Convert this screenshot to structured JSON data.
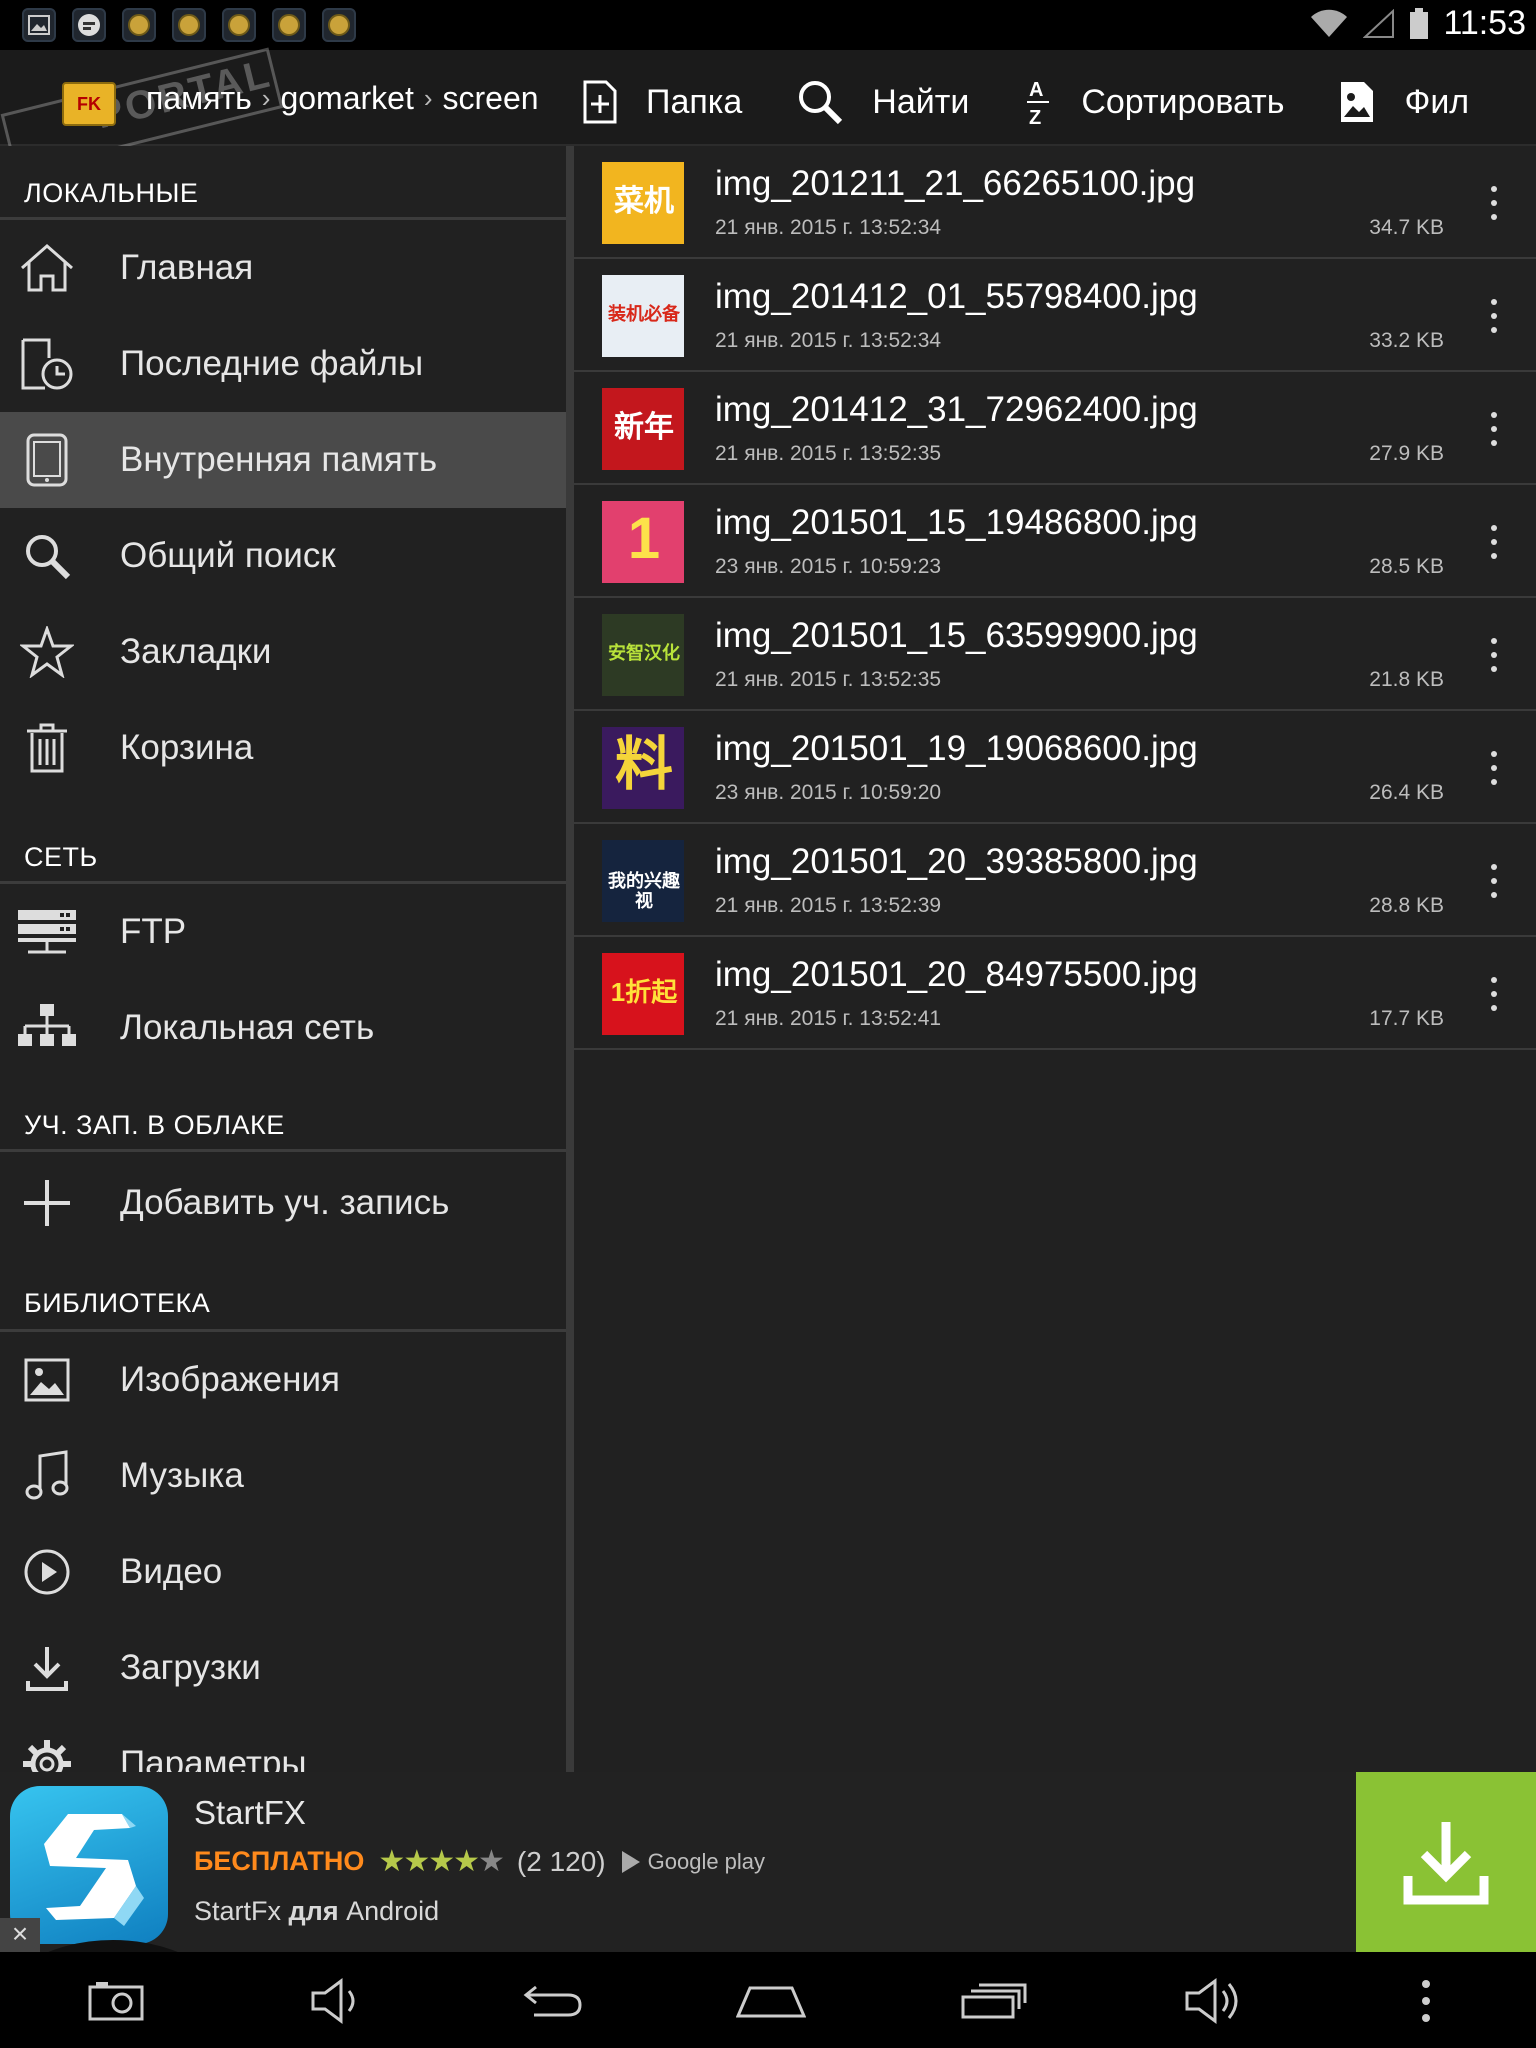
{
  "status_bar": {
    "time": "11:53"
  },
  "action_bar": {
    "watermark": "PORTAL",
    "app_logo": "FK",
    "breadcrumb": [
      "память",
      "gomarket",
      "screen"
    ],
    "toolbar": [
      {
        "label": "Папка",
        "icon": "new-folder-icon"
      },
      {
        "label": "Найти",
        "icon": "search-icon"
      },
      {
        "label": "Сортировать",
        "icon": "sort-az-icon"
      },
      {
        "label": "Фил",
        "icon": "image-filter-icon"
      }
    ]
  },
  "sidebar": {
    "sections": [
      {
        "header": "ЛОКАЛЬНЫЕ",
        "items": [
          {
            "label": "Главная",
            "icon": "home-icon"
          },
          {
            "label": "Последние файлы",
            "icon": "recent-files-icon"
          },
          {
            "label": "Внутренняя память",
            "icon": "tablet-icon",
            "active": true
          },
          {
            "label": "Общий поиск",
            "icon": "search-icon"
          },
          {
            "label": "Закладки",
            "icon": "star-icon"
          },
          {
            "label": "Корзина",
            "icon": "trash-icon"
          }
        ]
      },
      {
        "header": "СЕТЬ",
        "items": [
          {
            "label": "FTP",
            "icon": "ftp-server-icon"
          },
          {
            "label": "Локальная сеть",
            "icon": "network-icon"
          }
        ]
      },
      {
        "header": "УЧ. ЗАП. В ОБЛАКЕ",
        "items": [
          {
            "label": "Добавить уч. запись",
            "icon": "plus-icon"
          }
        ]
      },
      {
        "header": "БИБЛИОТЕКА",
        "items": [
          {
            "label": "Изображения",
            "icon": "image-icon"
          },
          {
            "label": "Музыка",
            "icon": "music-note-icon"
          },
          {
            "label": "Видео",
            "icon": "play-circle-icon"
          },
          {
            "label": "Загрузки",
            "icon": "download-icon"
          },
          {
            "label": "Параметры",
            "icon": "gear-icon"
          }
        ]
      }
    ]
  },
  "files": [
    {
      "name": "img_201211_21_66265100.jpg",
      "date": "21 янв. 2015 г. 13:52:34",
      "size": "34.7 KB",
      "thumb_bg": "#f2b51f",
      "thumb_text": "菜机",
      "thumb_color": "#ffffff"
    },
    {
      "name": "img_201412_01_55798400.jpg",
      "date": "21 янв. 2015 г. 13:52:34",
      "size": "33.2 KB",
      "thumb_bg": "#e8eef4",
      "thumb_text": "装机必备",
      "thumb_color": "#d8281a"
    },
    {
      "name": "img_201412_31_72962400.jpg",
      "date": "21 янв. 2015 г. 13:52:35",
      "size": "27.9 KB",
      "thumb_bg": "#c3171d",
      "thumb_text": "新年",
      "thumb_color": "#ffffff"
    },
    {
      "name": "img_201501_15_19486800.jpg",
      "date": "23 янв. 2015 г. 10:59:23",
      "size": "28.5 KB",
      "thumb_bg": "#e2406e",
      "thumb_text": "1",
      "thumb_color": "#fde24a"
    },
    {
      "name": "img_201501_15_63599900.jpg",
      "date": "21 янв. 2015 г. 13:52:35",
      "size": "21.8 KB",
      "thumb_bg": "#2d3a24",
      "thumb_text": "安智汉化",
      "thumb_color": "#b8e23a"
    },
    {
      "name": "img_201501_19_19068600.jpg",
      "date": "23 янв. 2015 г. 10:59:20",
      "size": "26.4 KB",
      "thumb_bg": "#3a1a5e",
      "thumb_text": "料",
      "thumb_color": "#f5d53a"
    },
    {
      "name": "img_201501_20_39385800.jpg",
      "date": "21 янв. 2015 г. 13:52:39",
      "size": "28.8 KB",
      "thumb_bg": "#15243e",
      "thumb_text": "我的兴趣视",
      "thumb_color": "#ffffff"
    },
    {
      "name": "img_201501_20_84975500.jpg",
      "date": "21 янв. 2015 г. 13:52:41",
      "size": "17.7 KB",
      "thumb_bg": "#d7121c",
      "thumb_text": "1折起",
      "thumb_color": "#ffe13a"
    }
  ],
  "ad": {
    "title": "StartFX",
    "free_label": "БЕСПЛАТНО",
    "rating": 4,
    "reviews": "(2 120)",
    "store": "Google play",
    "subtitle_pre": "StartFx",
    "subtitle_bold": "для",
    "subtitle_post": "Android",
    "close": "×",
    "colors": {
      "free": "#ff8a1c",
      "download_bg": "#8ac234"
    }
  }
}
